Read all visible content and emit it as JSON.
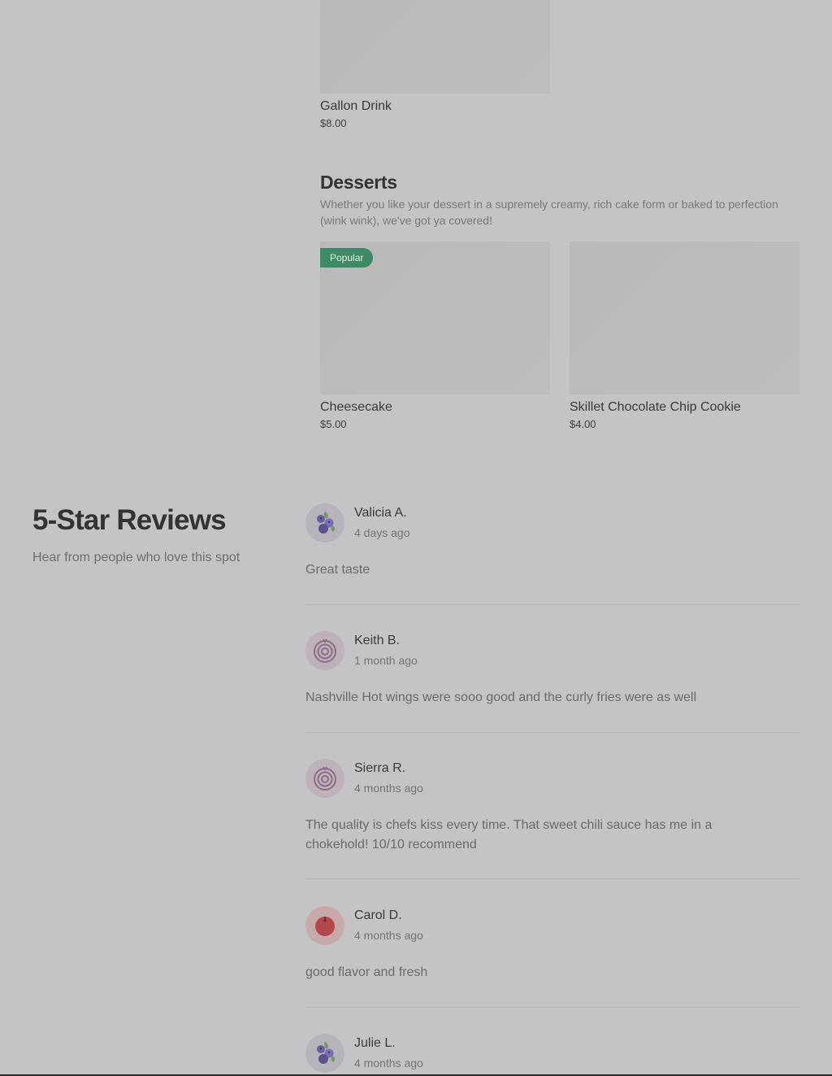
{
  "menu": {
    "drinks": {
      "items": [
        {
          "name": "Gallon Drink",
          "price": "$8.00"
        }
      ]
    },
    "desserts": {
      "title": "Desserts",
      "description": "Whether you like your dessert in a supremely creamy, rich cake form or baked to perfection (wink wink), we've got ya covered!",
      "items": [
        {
          "name": "Cheesecake",
          "price": "$5.00",
          "badge": "Popular"
        },
        {
          "name": "Skillet Chocolate Chip Cookie",
          "price": "$4.00"
        }
      ]
    }
  },
  "reviews": {
    "title": "5-Star Reviews",
    "subtitle": "Hear from people who love this spot",
    "items": [
      {
        "name": "Valicia A.",
        "time": "4 days ago",
        "text": "Great taste",
        "avatar_icon": "blueberry-icon"
      },
      {
        "name": "Keith B.",
        "time": "1 month ago",
        "text": "Nashville Hot wings were sooo good and the curly fries were as well",
        "avatar_icon": "onion-icon"
      },
      {
        "name": "Sierra R.",
        "time": "4 months ago",
        "text": "The quality is chefs kiss every time. That sweet chili sauce has me in a chokehold! 10/10 recommend",
        "avatar_icon": "onion-icon"
      },
      {
        "name": "Carol D.",
        "time": "4 months ago",
        "text": "good flavor and fresh",
        "avatar_icon": "tomato-icon"
      },
      {
        "name": "Julie L.",
        "time": "4 months ago",
        "text": "",
        "avatar_icon": "blueberry-icon"
      }
    ]
  },
  "colors": {
    "background": "#c4c4c4",
    "badge": "#3f8a66",
    "blueberry_avatar_bg": "#b6b3bb",
    "onion_avatar_bg": "#bdb2b9",
    "tomato_avatar_bg": "#c7a9aa"
  }
}
